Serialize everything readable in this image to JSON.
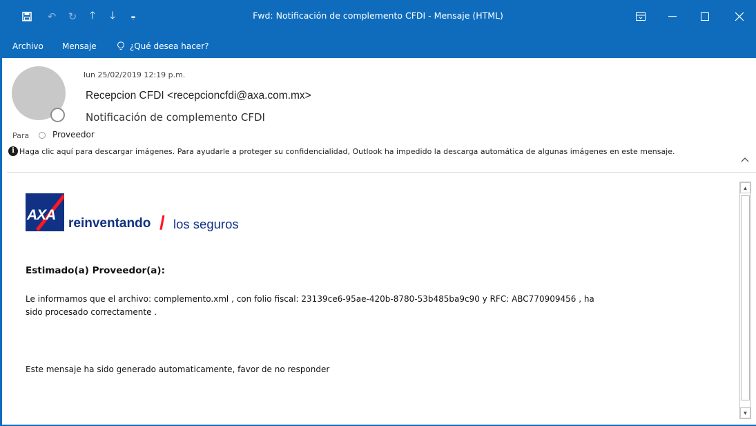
{
  "window": {
    "title": "Fwd: Notificación de complemento CFDI  -  Mensaje (HTML)",
    "accent_color": "#0f6cbd",
    "quick_access": {
      "save_icon": "save-icon",
      "undo_icon": "undo-icon",
      "redo_icon": "redo-icon",
      "prev_icon": "arrow-up-icon",
      "next_icon": "arrow-down-icon",
      "customize_icon": "customize-qat-icon"
    }
  },
  "menu": {
    "items": [
      "Archivo",
      "Mensaje"
    ],
    "tell_me": "¿Qué desea hacer?"
  },
  "header": {
    "date": "lun 25/02/2019 12:19 p.m.",
    "from": "Recepcion CFDI <recepcioncfdi@axa.com.mx>",
    "subject": "Notificación de complemento CFDI",
    "to_label": "Para",
    "to_name": "Proveedor",
    "info_bar": "Haga clic aquí para descargar imágenes. Para ayudarle a proteger su confidencialidad, Outlook ha impedido la descarga automática de algunas imágenes en este mensaje."
  },
  "body": {
    "logo": {
      "brand": "AXA",
      "tagline_bold": "reinventando",
      "tagline_light": "los seguros",
      "brand_blue": "#103184",
      "brand_red": "#ff1721"
    },
    "greeting": "Estimado(a) Proveedor(a):",
    "line1": "Le informamos que el archivo: complemento.xml , con folio fiscal: 23139ce6-95ae-420b-8780-53b485ba9c90 y RFC:  ABC770909456 , ha",
    "line2": "sido procesado correctamente .",
    "footer_note": "Este mensaje ha sido generado automaticamente, favor de no responder"
  }
}
